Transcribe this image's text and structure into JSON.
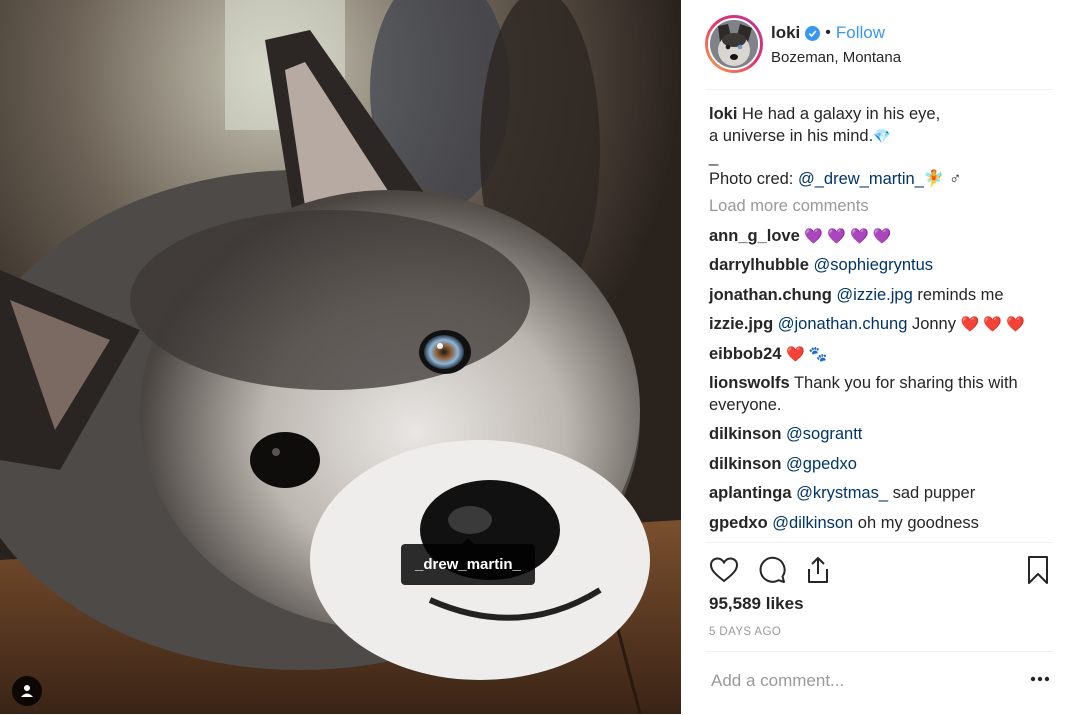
{
  "post": {
    "username": "loki",
    "follow_label": "Follow",
    "separator": "•",
    "location": "Bozeman, Montana",
    "photo_tag": "_drew_martin_"
  },
  "caption": {
    "username": "loki",
    "line1": "He had a galaxy in his eye,",
    "line2": "a universe in his mind.",
    "line3": "_",
    "line4_prefix": "Photo cred: ",
    "line4_mention": "@_drew_martin_",
    "line4_suffix": "🧚 ♂"
  },
  "load_more": "Load more comments",
  "comments": [
    {
      "user": "ann_g_love",
      "text": "",
      "emoji": "💜 💜 💜 💜"
    },
    {
      "user": "darrylhubble",
      "mention": "@sophiegryntus",
      "text": ""
    },
    {
      "user": "jonathan.chung",
      "mention": "@izzie.jpg",
      "text": " reminds me"
    },
    {
      "user": "izzie.jpg",
      "mention": "@jonathan.chung",
      "text": " Jonny ",
      "emoji": "❤️ ❤️ ❤️"
    },
    {
      "user": "eibbob24",
      "text": "",
      "emoji": "❤️ 🐾"
    },
    {
      "user": "lionswolfs",
      "text": " Thank you for sharing this with everyone."
    },
    {
      "user": "dilkinson",
      "mention": "@sograntt",
      "text": ""
    },
    {
      "user": "dilkinson",
      "mention": "@gpedxo",
      "text": ""
    },
    {
      "user": "aplantinga",
      "mention": "@krystmas_",
      "text": " sad pupper"
    },
    {
      "user": "gpedxo",
      "mention": "@dilkinson",
      "text": " oh my goodness"
    }
  ],
  "likes": "95,589 likes",
  "timestamp": "5 DAYS AGO",
  "add_comment": {
    "placeholder": "Add a comment..."
  },
  "icons": {
    "like": "heart-icon",
    "comment": "comment-icon",
    "share": "share-icon",
    "save": "bookmark-icon",
    "more": "more-options-icon",
    "user_tag": "user-tag-icon",
    "verified": "verified-badge-icon"
  },
  "colors": {
    "accent": "#3897f0",
    "mention": "#003569",
    "muted": "#999999"
  }
}
